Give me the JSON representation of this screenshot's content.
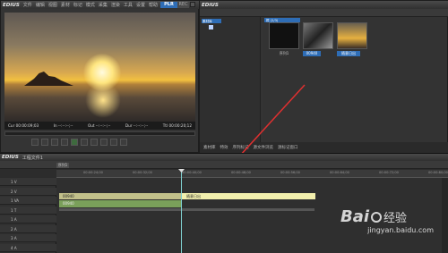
{
  "player": {
    "app_name": "EDIUS",
    "menu": [
      "文件",
      "编辑",
      "视图",
      "素材",
      "标记",
      "模式",
      "采集",
      "渲染",
      "工具",
      "设置",
      "帮助"
    ],
    "plr_label": "PLR",
    "rec_label": "REC",
    "cur_label": "Cur 00:00:09;03",
    "in_label": "In --:--:--;--",
    "out_label": "Out --:--:--;--",
    "dur_label": "Dur --:--:--;--",
    "ttl_label": "Ttl 00:00:20;12"
  },
  "bin": {
    "app_name": "EDIUS",
    "folder_label": "素材库",
    "bin_path": "根 (2/3)",
    "clips": [
      {
        "label": "序列1",
        "kind": "sequence"
      },
      {
        "label": "00940",
        "kind": "video"
      },
      {
        "label": "随意日出",
        "kind": "image"
      }
    ],
    "tabs": [
      "素材库",
      "特效",
      "序列标记",
      "源文件浏览",
      "源标记窗口"
    ]
  },
  "timeline": {
    "app_name": "EDIUS",
    "project": "工程文件1",
    "seq_tab": "序列1",
    "ruler_ticks": [
      "00:00:24;00",
      "00:00:32;00",
      "00:00:40;00",
      "00:00:48;00",
      "00:00:56;00",
      "00:00:64;00",
      "00:00:72;00",
      "00:00:80;00"
    ],
    "tracks": [
      "1 V",
      "2 V",
      "1 VA",
      "1 T",
      "1 A",
      "2 A",
      "3 A",
      "4 A"
    ],
    "clip_video_a": "00940",
    "clip_video_b": "随意日出",
    "clip_audio": "00940"
  },
  "watermark": {
    "logo_text": "Bai",
    "logo_text_cn": "经验",
    "url": "jingyan.baidu.com"
  }
}
